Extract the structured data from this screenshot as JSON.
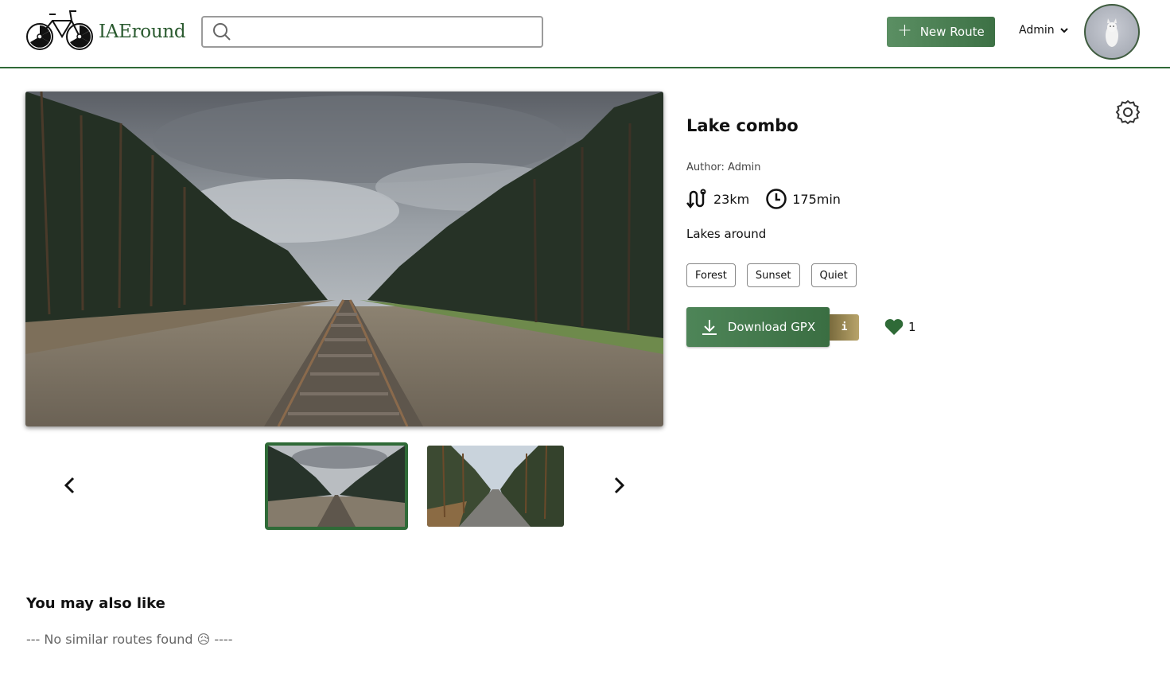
{
  "header": {
    "logo_text": "IAEround",
    "search": {
      "value": "",
      "placeholder": ""
    },
    "new_route_label": "New Route",
    "user_name": "Admin"
  },
  "route": {
    "title": "Lake combo",
    "author": "Author: Admin",
    "distance": "23km",
    "duration": "175min",
    "description": "Lakes around",
    "tags": [
      "Forest",
      "Sunset",
      "Quiet"
    ],
    "download_label": "Download GPX",
    "info_label": "i",
    "likes": "1"
  },
  "gallery": {
    "images": [
      "railway-through-forest",
      "road-through-pine-forest"
    ],
    "active_index": 0
  },
  "similar": {
    "heading": "You may also like",
    "empty_message": "--- No similar routes found 😥 ----"
  },
  "colors": {
    "brand_green": "#2f6a37",
    "button_green": "#4e8558",
    "info_gold": "#b8a46a",
    "heart_green": "#2f6a37"
  },
  "icons": [
    "bicycle-logo-icon",
    "search-icon",
    "plus-icon",
    "chevron-down-icon",
    "gear-icon",
    "route-icon",
    "clock-icon",
    "download-icon",
    "heart-icon",
    "chevron-left-icon",
    "chevron-right-icon"
  ]
}
